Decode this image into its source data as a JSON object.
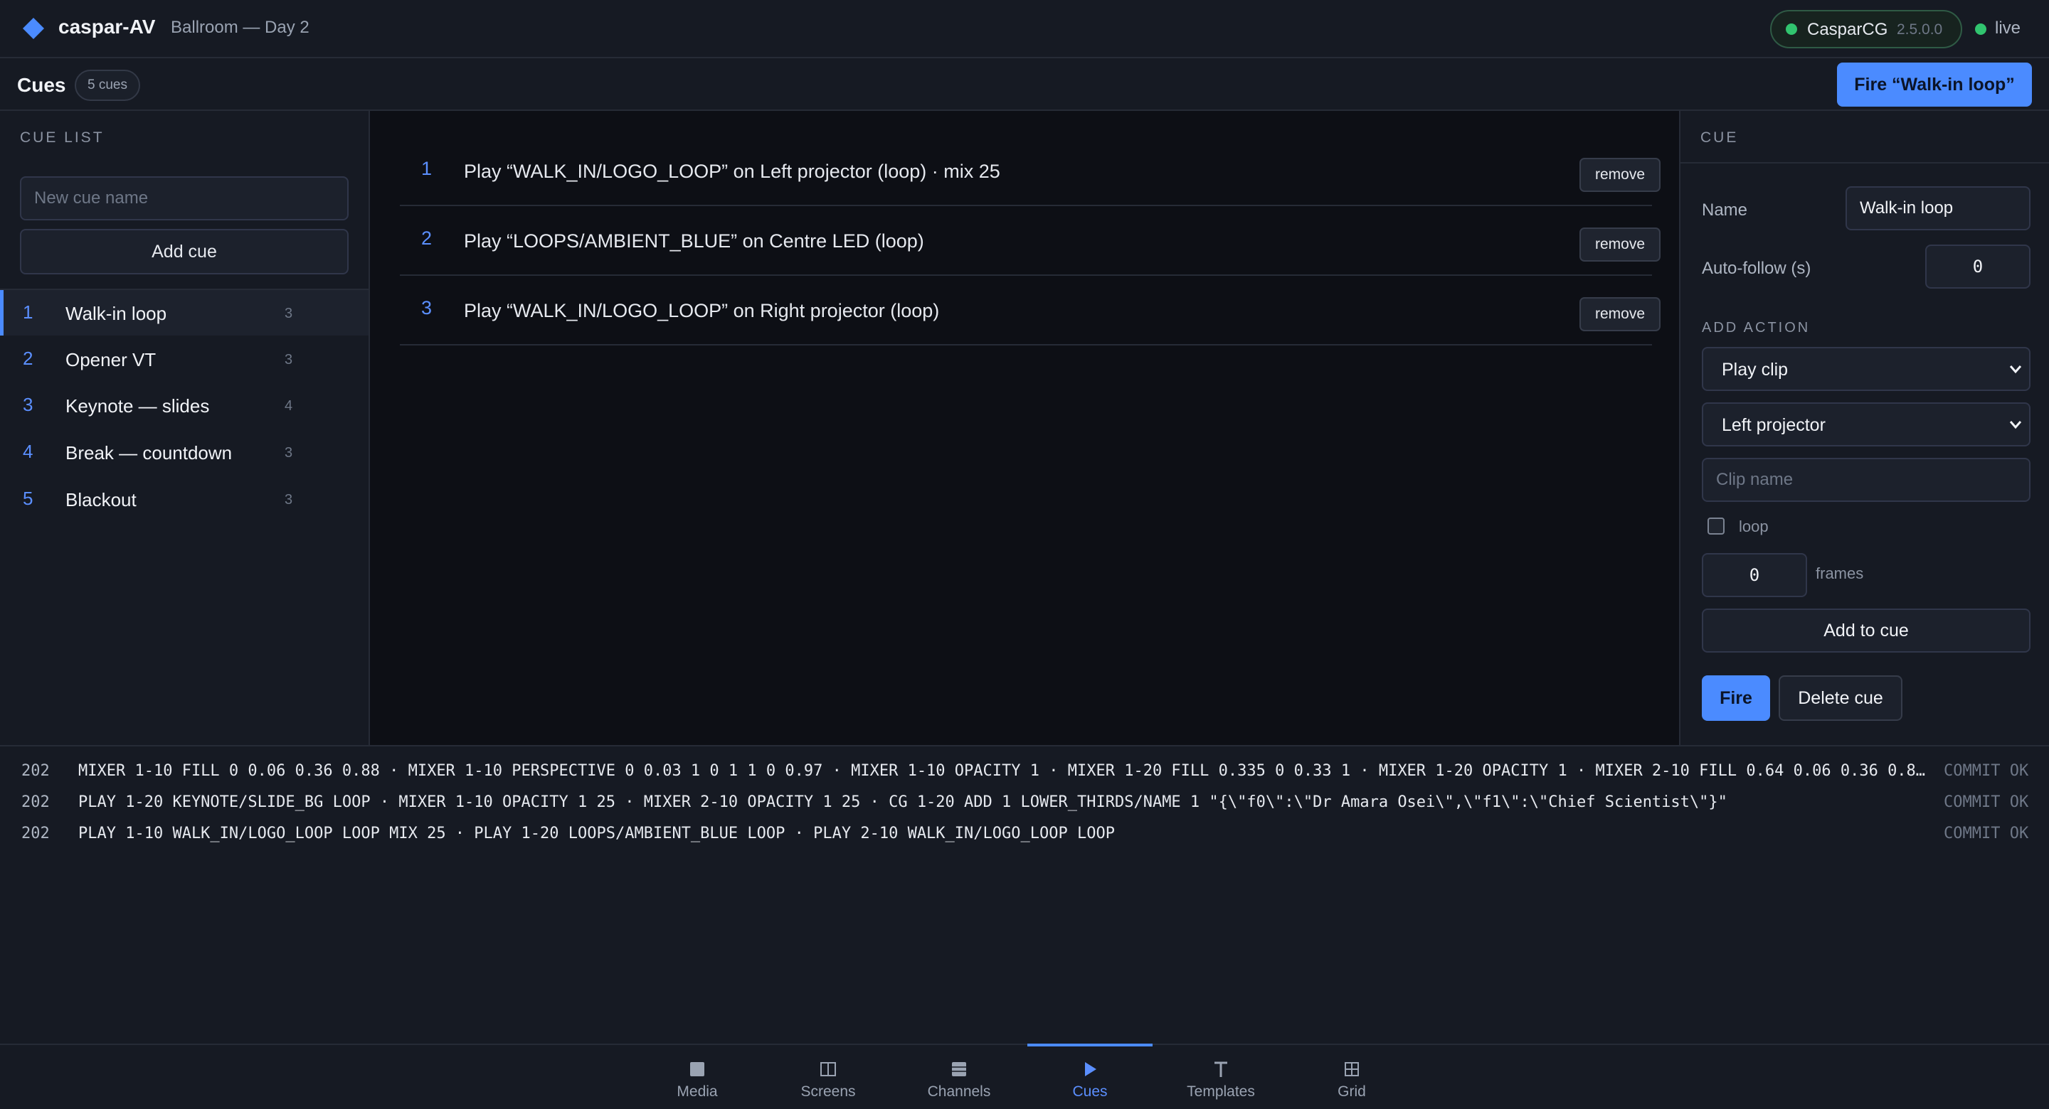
{
  "app": {
    "name": "caspar-AV",
    "project": "Ballroom — Day 2",
    "server_name": "CasparCG",
    "server_version": "2.5.0.0",
    "live_label": "live",
    "accent": "#4b8bff",
    "live_color": "#31c46f"
  },
  "subbar": {
    "title": "Cues",
    "count": "5 cues",
    "fire_label": "Fire “Walk-in loop”"
  },
  "cue_list": {
    "heading": "CUE LIST",
    "new_cue_placeholder": "New cue name",
    "add_label": "Add cue",
    "items": [
      {
        "num": "1",
        "name": "Walk-in loop",
        "actions": "3",
        "selected": true
      },
      {
        "num": "2",
        "name": "Opener VT",
        "actions": "3"
      },
      {
        "num": "3",
        "name": "Keynote — slides",
        "actions": "4"
      },
      {
        "num": "4",
        "name": "Break — countdown",
        "actions": "3"
      },
      {
        "num": "5",
        "name": "Blackout",
        "actions": "3"
      }
    ]
  },
  "actions": [
    {
      "num": "1",
      "text": "Play “WALK_IN/LOGO_LOOP” on Left projector (loop) · mix 25",
      "remove": "remove"
    },
    {
      "num": "2",
      "text": "Play “LOOPS/AMBIENT_BLUE” on Centre LED (loop)",
      "remove": "remove"
    },
    {
      "num": "3",
      "text": "Play “WALK_IN/LOGO_LOOP” on Right projector (loop)",
      "remove": "remove"
    }
  ],
  "inspector": {
    "heading": "CUE",
    "name_label": "Name",
    "name_value": "Walk-in loop",
    "autofollow_label": "Auto-follow (s)",
    "autofollow_value": "0",
    "add_action_heading": "ADD ACTION",
    "action_type": "Play clip",
    "target": "Left projector",
    "clip_placeholder": "Clip name",
    "loop_label": "loop",
    "frames_value": "0",
    "frames_label": "frames",
    "add_to_cue_label": "Add to cue",
    "fire_label": "Fire",
    "delete_label": "Delete cue"
  },
  "log": [
    {
      "code": "202",
      "cmd": "MIXER 1-10 FILL 0 0.06 0.36 0.88 · MIXER 1-10 PERSPECTIVE 0 0.03 1 0 1 1 0 0.97 · MIXER 1-10 OPACITY 1 · MIXER 1-20 FILL 0.335 0 0.33 1 · MIXER 1-20 OPACITY 1 · MIXER 2-10 FILL 0.64 0.06 0.36 0.8…",
      "status": "COMMIT OK"
    },
    {
      "code": "202",
      "cmd": "PLAY 1-20 KEYNOTE/SLIDE_BG LOOP · MIXER 1-10 OPACITY 1 25 · MIXER 2-10 OPACITY 1 25 · CG 1-20 ADD 1 LOWER_THIRDS/NAME 1 \"{\\\"f0\\\":\\\"Dr Amara Osei\\\",\\\"f1\\\":\\\"Chief Scientist\\\"}\"",
      "status": "COMMIT OK"
    },
    {
      "code": "202",
      "cmd": "PLAY 1-10 WALK_IN/LOGO_LOOP LOOP MIX 25 · PLAY 1-20 LOOPS/AMBIENT_BLUE LOOP · PLAY 2-10 WALK_IN/LOGO_LOOP LOOP",
      "status": "COMMIT OK"
    }
  ],
  "nav": [
    {
      "label": "Media",
      "icon": "media-icon"
    },
    {
      "label": "Screens",
      "icon": "screens-icon"
    },
    {
      "label": "Channels",
      "icon": "channels-icon"
    },
    {
      "label": "Cues",
      "icon": "play-icon",
      "active": true
    },
    {
      "label": "Templates",
      "icon": "templates-icon"
    },
    {
      "label": "Grid",
      "icon": "grid-icon"
    }
  ]
}
